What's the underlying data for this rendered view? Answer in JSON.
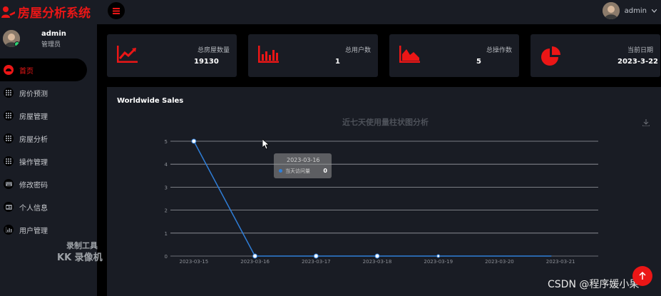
{
  "app": {
    "title": "房屋分析系统",
    "brand_color": "#eb1616"
  },
  "topbar": {
    "username": "admin"
  },
  "profile": {
    "name": "admin",
    "role": "管理员"
  },
  "nav": [
    {
      "label": "首页",
      "active": true,
      "icon": "dashboard-icon"
    },
    {
      "label": "房价预测",
      "icon": "grid-icon"
    },
    {
      "label": "房屋管理",
      "icon": "grid-icon"
    },
    {
      "label": "房屋分析",
      "icon": "grid-icon"
    },
    {
      "label": "操作管理",
      "icon": "grid-icon"
    },
    {
      "label": "修改密码",
      "icon": "keyboard-icon"
    },
    {
      "label": "个人信息",
      "icon": "id-card-icon"
    },
    {
      "label": "用户管理",
      "icon": "bar-chart-icon"
    }
  ],
  "stats": [
    {
      "label": "总房屋数量",
      "value": "19130",
      "icon": "trend-chart-icon"
    },
    {
      "label": "总用户数",
      "value": "1",
      "icon": "bar-chart-icon"
    },
    {
      "label": "总操作数",
      "value": "5",
      "icon": "area-chart-icon"
    },
    {
      "label": "当前日期",
      "value": "2023-3-22",
      "icon": "pie-chart-icon"
    }
  ],
  "panel": {
    "title": "Worldwide Sales"
  },
  "chart_data": {
    "type": "line",
    "title": "近七天使用量柱状图分析",
    "x": [
      "2023-03-15",
      "2023-03-16",
      "2023-03-17",
      "2023-03-18",
      "2023-03-19",
      "2023-03-20",
      "2023-03-21"
    ],
    "y_ticks": [
      "0",
      "1",
      "2",
      "3",
      "4",
      "5"
    ],
    "series": [
      {
        "name": "当天访问量",
        "values": [
          5,
          0,
          0,
          0,
          0,
          0,
          null
        ],
        "color": "#2f7ed8"
      }
    ],
    "ylim": [
      0,
      5
    ],
    "grid": true,
    "tooltip": {
      "date": "2023-03-16",
      "label": "当天访问量",
      "value": "0"
    }
  },
  "watermark": {
    "line1": "录制工具",
    "line2": "KK 录像机"
  },
  "footer": {
    "credit": "CSDN @程序媛小果"
  }
}
